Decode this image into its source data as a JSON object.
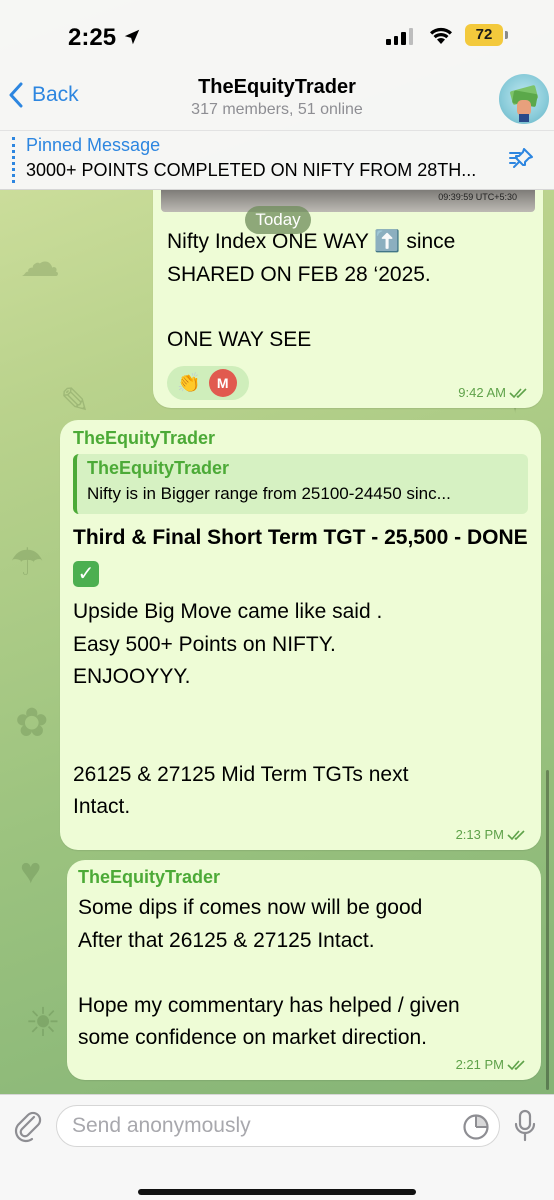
{
  "status_bar": {
    "time": "2:25",
    "battery": "72"
  },
  "header": {
    "back_label": "Back",
    "title": "TheEquityTrader",
    "subtitle": "317 members, 51 online"
  },
  "pinned": {
    "label": "Pinned Message",
    "text": "3000+ POINTS COMPLETED ON NIFTY FROM 28TH..."
  },
  "date_separator": "Today",
  "messages": [
    {
      "photo_timestamp": "09:39:59 UTC+5:30",
      "text": "Nifty Index ONE WAY ⬆️ since\nSHARED ON FEB 28 ‘2025.\n\nONE WAY SEE",
      "reaction_emoji": "👏",
      "reaction_avatar": "M",
      "time": "9:42 AM"
    },
    {
      "sender": "TheEquityTrader",
      "reply_sender": "TheEquityTrader",
      "reply_text": "Nifty is in Bigger range from 25100-24450 sinc...",
      "headline": "Third & Final Short Term TGT - 25,500 - DONE",
      "headline_emoji": "✓",
      "text": "Upside Big Move came like said .\nEasy 500+ Points on NIFTY.\nENJOOYYY.\n\n\n26125 & 27125 Mid Term TGTs next\nIntact.",
      "time": "2:13 PM"
    },
    {
      "sender": "TheEquityTrader",
      "text": "Some dips if comes now will be good\nAfter that 26125 & 27125 Intact.\n\nHope my commentary has helped / given\nsome confidence on market direction.",
      "time": "2:21 PM"
    }
  ],
  "composer": {
    "placeholder": "Send anonymously"
  },
  "icons": {
    "back": "chevron-left-icon",
    "pin": "pin-list-icon",
    "attach": "paperclip-icon",
    "sticker": "sticker-icon",
    "mic": "microphone-icon"
  },
  "colors": {
    "accent": "#2d86e0",
    "sender": "#4caa37",
    "bubble": "#eefcd6",
    "battery": "#f3c93c"
  }
}
